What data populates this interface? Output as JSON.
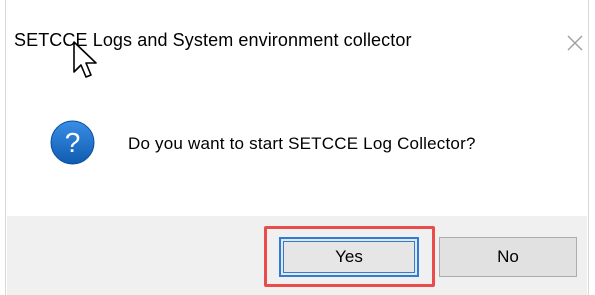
{
  "dialog": {
    "title": "SETCCE Logs and System environment collector",
    "message": "Do you want to start SETCCE Log Collector?",
    "icon": "question-icon",
    "close_icon": "close-icon"
  },
  "buttons": {
    "yes_label": "Yes",
    "no_label": "No"
  },
  "annotation": {
    "highlight_color": "#ea4b4b",
    "highlighted_button": "Yes"
  },
  "colors": {
    "icon_blue": "#1a6fc4",
    "focus_border": "#2e7bd8",
    "footer_bg": "#f0f0f0"
  }
}
